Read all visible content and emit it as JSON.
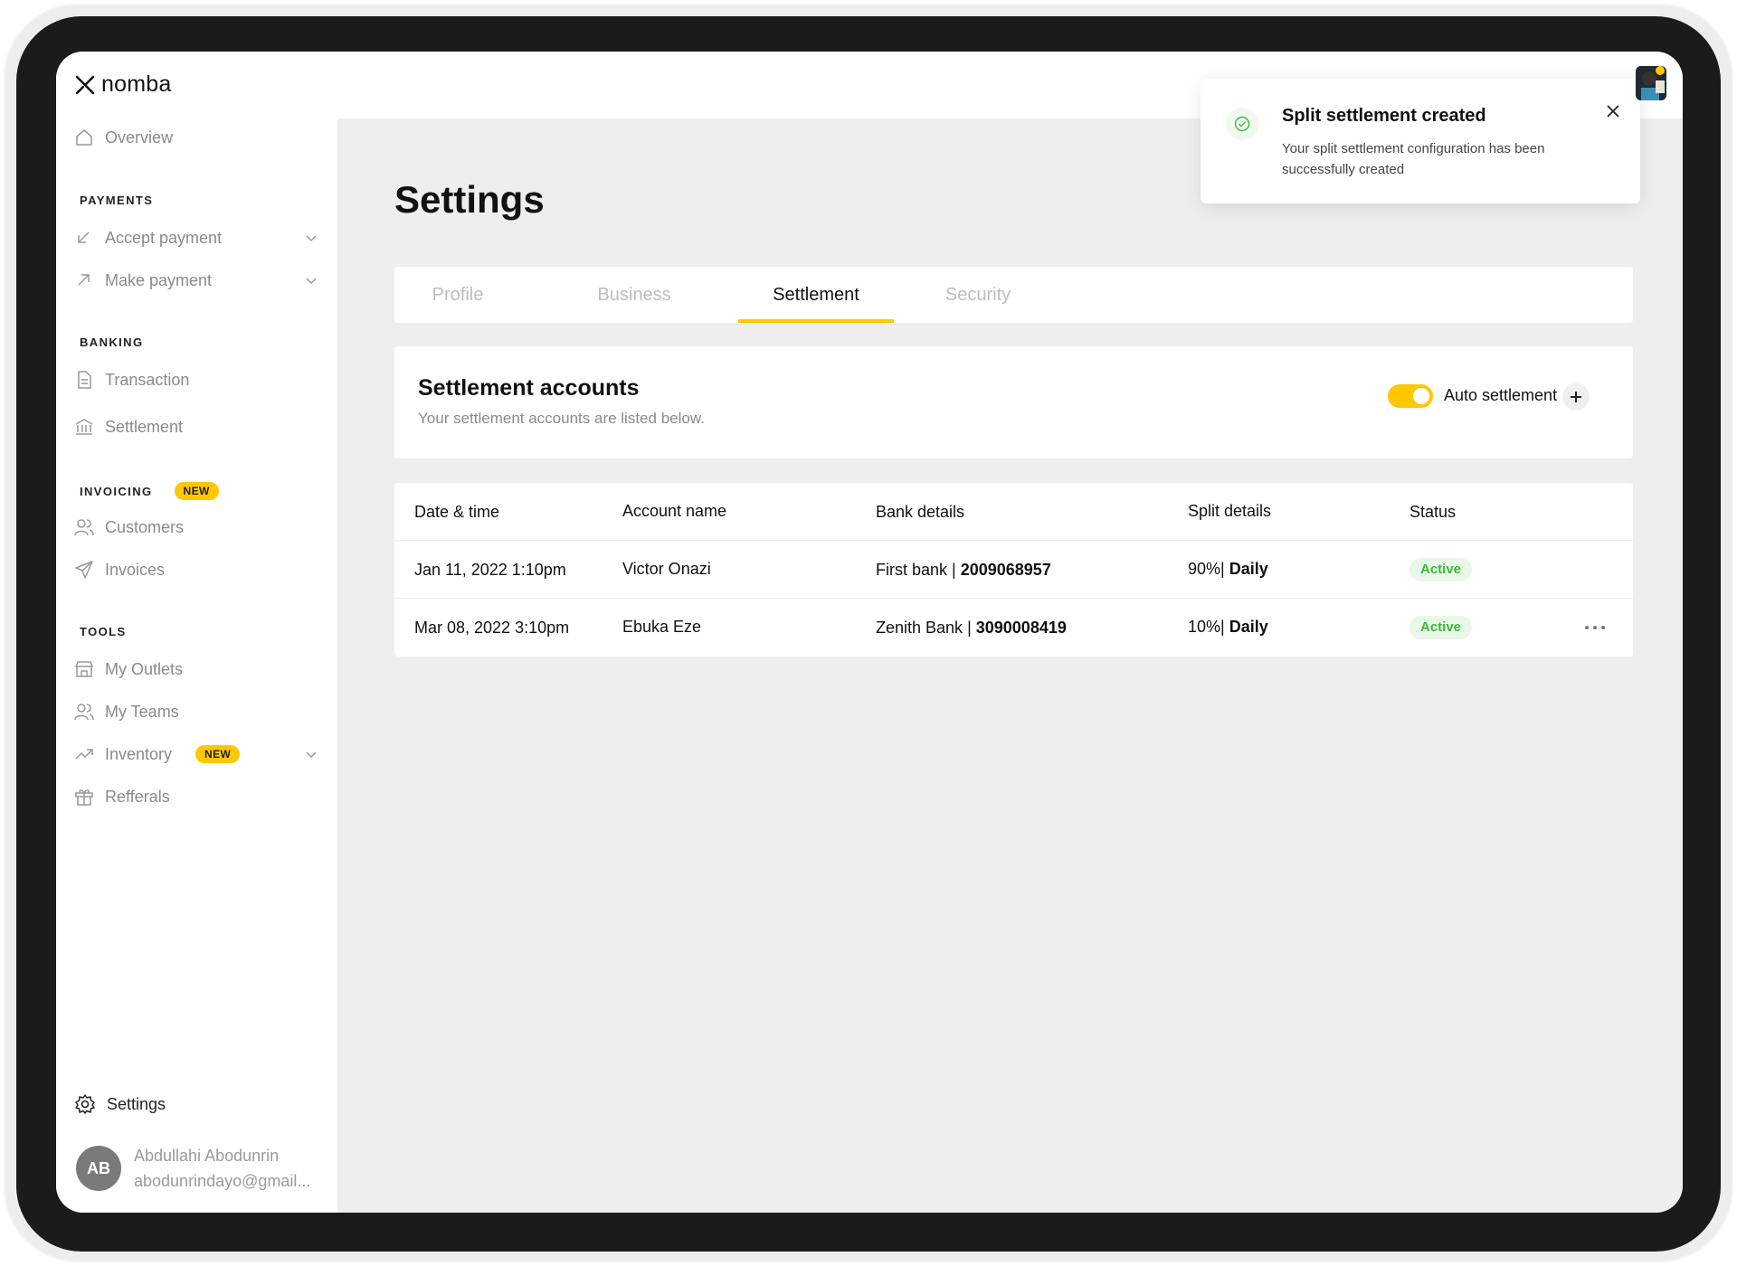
{
  "brand": {
    "name": "nomba"
  },
  "sidebar": {
    "overview": "Overview",
    "sections": {
      "payments": "PAYMENTS",
      "banking": "BANKING",
      "invoicing": "INVOICING",
      "tools": "TOOLS"
    },
    "payments": [
      "Accept payment",
      "Make payment"
    ],
    "banking": [
      "Transaction",
      "Settlement"
    ],
    "invoicing": [
      "Customers",
      "Invoices"
    ],
    "tools": [
      "My Outlets",
      "My Teams",
      "Inventory",
      "Refferals"
    ],
    "new_badge": "NEW",
    "settings": "Settings",
    "user": {
      "initials": "AB",
      "name": "Abdullahi Abodunrin",
      "email": "abodunrindayo@gmail..."
    }
  },
  "page": {
    "title": "Settings"
  },
  "tabs": [
    "Profile",
    "Business",
    "Settlement",
    "Security"
  ],
  "active_tab": "Settlement",
  "settlement": {
    "title": "Settlement accounts",
    "subtitle": "Your settlement accounts are listed below.",
    "auto_settlement_label": "Auto settlement",
    "auto_settlement_on": true,
    "add_icon": "plus-icon"
  },
  "table": {
    "headers": [
      "Date & time",
      "Account name",
      "Bank details",
      "Split details",
      "Status"
    ],
    "rows": [
      {
        "date": "Jan 11, 2022 1:10pm",
        "account": "Victor Onazi",
        "bank": "First bank",
        "number": "2009068957",
        "split_pct": "90%",
        "split_freq": "Daily",
        "status": "Active"
      },
      {
        "date": "Mar 08, 2022 3:10pm",
        "account": "Ebuka Eze",
        "bank": "Zenith Bank",
        "number": "3090008419",
        "split_pct": "10%",
        "split_freq": "Daily",
        "status": "Active"
      }
    ]
  },
  "toast": {
    "title": "Split settlement created",
    "message": "Your split settlement configuration has been successfully created"
  },
  "colors": {
    "accent": "#ffc700",
    "success": "#3cb73c",
    "success_bg": "#e9f8e6",
    "content_bg": "#eeeeee"
  }
}
